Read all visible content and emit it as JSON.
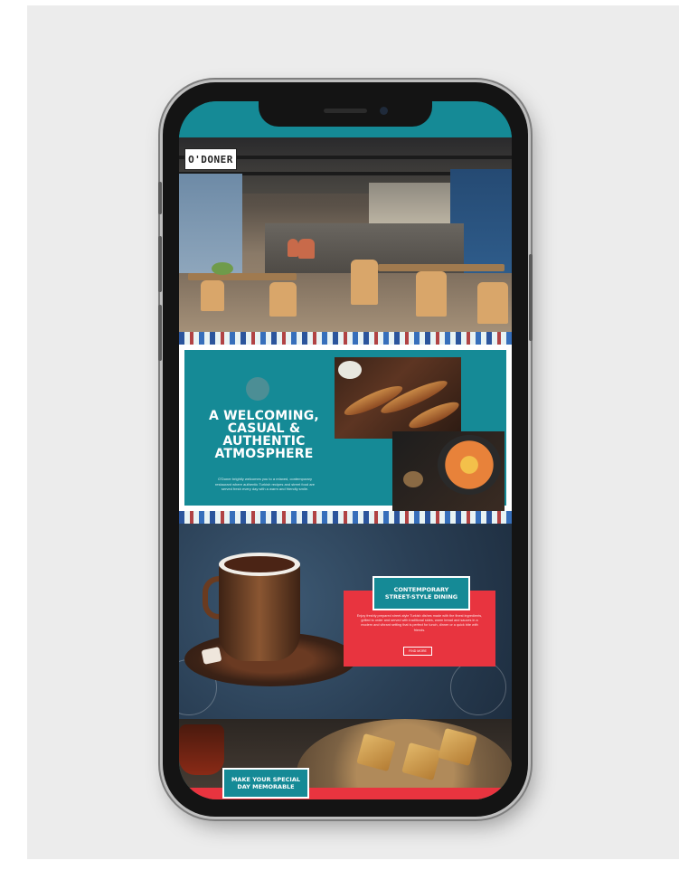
{
  "brand": {
    "logo": "O'DONER"
  },
  "welcome": {
    "heading_line1": "A WELCOMING,",
    "heading_line2": "CASUAL &",
    "heading_line3": "AUTHENTIC",
    "heading_line4": "ATMOSPHERE",
    "body": "O'Doner brightly welcomes you to a relaxed, contemporary restaurant where authentic Turkish recipes and street food are served fresh every day with a warm and friendly smile."
  },
  "dining": {
    "label_line1": "CONTEMPORARY",
    "label_line2": "STREET-STYLE DINING",
    "body": "Enjoy freshly prepared street-style Turkish dishes made with the finest ingredients, grilled to order and served with traditional sides, warm bread and sauces in a modern and vibrant setting that is perfect for lunch, dinner or a quick bite with friends.",
    "button": "FIND MORE"
  },
  "special": {
    "label_line1": "MAKE YOUR SPECIAL",
    "label_line2": "DAY MEMORABLE"
  },
  "colors": {
    "teal": "#158a96",
    "red": "#e8343f",
    "background": "#ececec"
  }
}
